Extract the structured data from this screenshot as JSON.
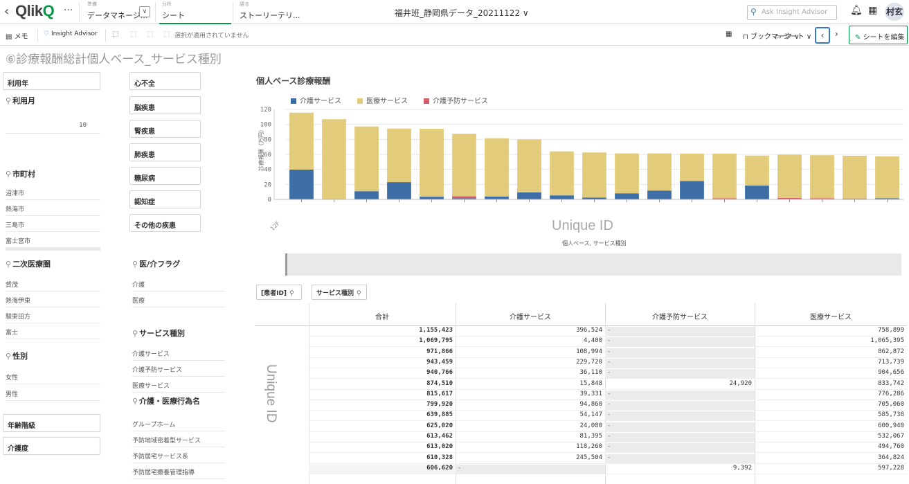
{
  "topbar": {
    "back_glyph": "‹",
    "logo_text": "Qlik",
    "logo_mark": "Q",
    "more_glyph": "···",
    "tabs": [
      {
        "small": "準備",
        "label": "データマネージ..."
      },
      {
        "small": "分析",
        "label": "シート"
      },
      {
        "small": "語る",
        "label": "ストーリーテリ..."
      }
    ],
    "app_title": "福井班_静岡県データ_20211122 ∨",
    "search_placeholder": "Ask Insight Advisor",
    "user_initials": "村玄"
  },
  "toolbar": {
    "memo_label": "メモ",
    "insight_label": "Insight Advisor",
    "selection_status": "選択が適用されていません",
    "bookmark_label": "ブックマーク ∨",
    "sheet_label": "シート ∨",
    "edit_label": "シートを編集"
  },
  "sheet_title": "⑥診療報酬総計個人ベース_サービス種別",
  "filters": {
    "riyou_nen": "利用年",
    "riyou_tsuki": {
      "title": "利用月",
      "value": "10"
    },
    "shichouson": {
      "title": "市町村",
      "items": [
        "沼津市",
        "熱海市",
        "三島市",
        "富士宮市"
      ]
    },
    "niji_iryouken": {
      "title": "二次医療圏",
      "items": [
        "賀茂",
        "熱海伊東",
        "駿東田方",
        "富士"
      ]
    },
    "seibetsu": {
      "title": "性別",
      "items": [
        "女性",
        "男性"
      ]
    },
    "nenrei_kaikyu": "年齢階級",
    "kaigodo": "介護度",
    "diseases": [
      "心不全",
      "脳疾患",
      "腎疾患",
      "肺疾患",
      "糖尿病",
      "認知症",
      "その他の疾患"
    ],
    "ikai_flag": {
      "title": "医/介フラグ",
      "items": [
        "介護",
        "医療"
      ]
    },
    "service_shubetsu": {
      "title": "サービス種別",
      "items": [
        "介護サービス",
        "介護予防サービス",
        "医療サービス"
      ]
    },
    "kaigo_iryou_koui": {
      "title": "介護・医療行為名",
      "items": [
        "グループホーム",
        "予防地域密着型サービス",
        "予防居宅サービス系",
        "予防居宅療養管理指導"
      ]
    }
  },
  "chart_data": {
    "type": "bar",
    "stacked": true,
    "title": "個人ベース診療報酬",
    "ylabel": "診療報酬（万円）",
    "xlabel": "Unique ID",
    "xsublabel": "個人ベース, サービス種別",
    "x_tick_first": "12F",
    "ylim": [
      0,
      120
    ],
    "yticks": [
      0,
      20,
      40,
      60,
      80,
      100,
      120
    ],
    "legend_position": "top-left",
    "series": [
      {
        "name": "介護サービス",
        "color": "#3d6ea5",
        "values": [
          39.7,
          0.4,
          10.9,
          23.0,
          3.6,
          1.6,
          3.9,
          9.5,
          5.4,
          2.5,
          8.1,
          11.8,
          24.6,
          0.5,
          18.4,
          0.6,
          0.5,
          0.3,
          1.5
        ]
      },
      {
        "name": "介護予防サービス",
        "color": "#d65c6e",
        "values": [
          0,
          0,
          0,
          0,
          0,
          2.5,
          0,
          0,
          0,
          0,
          0,
          0,
          0,
          0.9,
          0,
          1.3,
          1.1,
          0.9,
          0
        ]
      },
      {
        "name": "医療サービス",
        "color": "#e3cb7c",
        "values": [
          75.9,
          106.5,
          86.3,
          71.4,
          90.5,
          83.4,
          77.6,
          70.5,
          58.6,
          60.1,
          53.2,
          49.5,
          36.5,
          59.7,
          40.0,
          57.6,
          57.3,
          57.0,
          56.0
        ]
      }
    ]
  },
  "table": {
    "row_dim": "[患者ID]",
    "col_dim": "サービス種別",
    "headers": [
      "合計",
      "介護サービス",
      "介護予防サービス",
      "医療サービス"
    ],
    "vertical_label": "Unique ID",
    "rows": [
      {
        "total": "1,155,423",
        "kaigo": "396,524",
        "yobou": "-",
        "iryou": "758,899"
      },
      {
        "total": "1,069,795",
        "kaigo": "4,400",
        "yobou": "-",
        "iryou": "1,065,395"
      },
      {
        "total": "971,866",
        "kaigo": "108,994",
        "yobou": "-",
        "iryou": "862,872"
      },
      {
        "total": "943,459",
        "kaigo": "229,720",
        "yobou": "-",
        "iryou": "713,739"
      },
      {
        "total": "940,766",
        "kaigo": "36,110",
        "yobou": "-",
        "iryou": "904,656"
      },
      {
        "total": "874,510",
        "kaigo": "15,848",
        "yobou": "24,920",
        "iryou": "833,742"
      },
      {
        "total": "815,617",
        "kaigo": "39,331",
        "yobou": "-",
        "iryou": "776,286"
      },
      {
        "total": "799,920",
        "kaigo": "94,860",
        "yobou": "-",
        "iryou": "705,060"
      },
      {
        "total": "639,885",
        "kaigo": "54,147",
        "yobou": "-",
        "iryou": "585,738"
      },
      {
        "total": "625,020",
        "kaigo": "24,080",
        "yobou": "-",
        "iryou": "600,940"
      },
      {
        "total": "613,462",
        "kaigo": "81,395",
        "yobou": "-",
        "iryou": "532,067"
      },
      {
        "total": "613,020",
        "kaigo": "118,260",
        "yobou": "-",
        "iryou": "494,760"
      },
      {
        "total": "610,328",
        "kaigo": "245,504",
        "yobou": "-",
        "iryou": "364,824"
      },
      {
        "total": "606,620",
        "kaigo": "-",
        "yobou": "9,392",
        "iryou": "597,228"
      }
    ]
  }
}
